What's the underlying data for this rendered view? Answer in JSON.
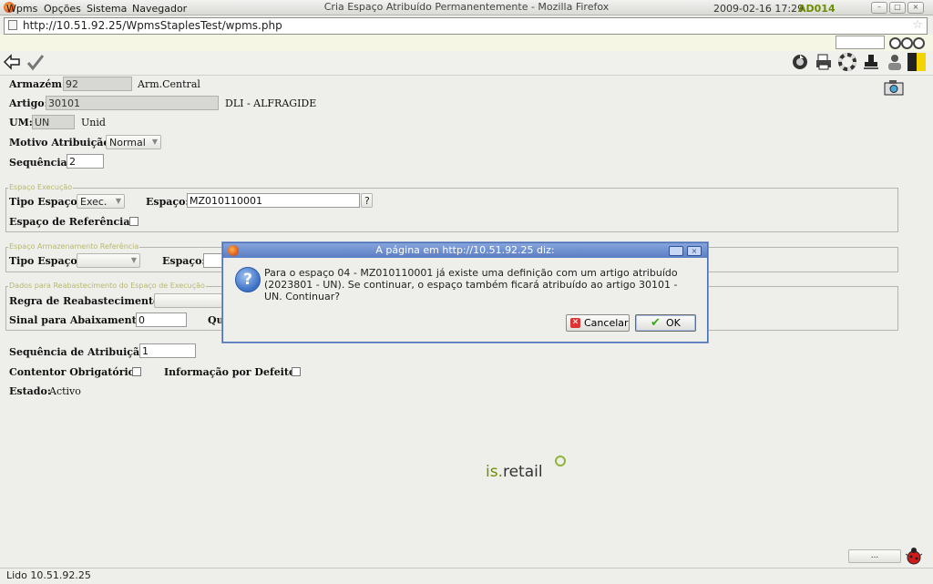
{
  "window": {
    "title": "Cria Espaço Atribuído Permanentemente - Mozilla Firefox"
  },
  "browser": {
    "url": "http://10.51.92.25/WpmsStaplesTest/wpms.php"
  },
  "menu": {
    "items": [
      "Wpms",
      "Opções",
      "Sistema",
      "Navegador"
    ],
    "datetime": "2009-02-16 17:29",
    "user": "AD014"
  },
  "form": {
    "armazem": {
      "label": "Armazém:",
      "value": "92",
      "desc": "Arm.Central"
    },
    "artigo": {
      "label": "Artigo:",
      "value": "30101",
      "desc": "DLI - ALFRAGIDE"
    },
    "um": {
      "label": "UM:",
      "value": "UN",
      "desc": "Unid"
    },
    "motivo": {
      "label": "Motivo Atribuição:",
      "value": "Normal"
    },
    "sequencia": {
      "label": "Sequência:",
      "value": "2"
    },
    "exec": {
      "legend": "Espaço Execução",
      "tipo_label": "Tipo Espaço:",
      "tipo_value": "Exec.",
      "espaco_label": "Espaço:",
      "espaco_value": "MZ010110001",
      "help": "?",
      "ref_label": "Espaço de Referência:"
    },
    "arm_ref": {
      "legend": "Espaço Armazenamento Referência",
      "tipo_label": "Tipo Espaço:",
      "espaco_label": "Espaço:"
    },
    "reab": {
      "legend": "Dados para Reabastecimento do Espaço de Execução",
      "regra_label": "Regra de Reabastecimento:",
      "sinal_label": "Sinal para Abaixamento:",
      "sinal_value": "0",
      "qu_label": "Qu"
    },
    "seq_atrib": {
      "label": "Sequência de Atribuição:",
      "value": "1"
    },
    "contentor": {
      "label": "Contentor Obrigatório:"
    },
    "info_defeito": {
      "label": "Informação por Defeito:"
    },
    "estado": {
      "label": "Estado:",
      "value": "Activo"
    }
  },
  "logo": {
    "text_a": "is.",
    "text_b": "retail"
  },
  "dialog": {
    "title": "A página em http://10.51.92.25 diz:",
    "message": "Para o espaço 04 - MZ010110001 já existe uma definição com um artigo atribuído (2023801 - UN). Se continuar, o espaço também ficará atribuído ao artigo 30101 - UN. Continuar?",
    "cancel_label": "Cancelar",
    "ok_label": "OK"
  },
  "bottom_button": "...",
  "status": "Lido 10.51.92.25",
  "colors": {
    "accent": "#6b8e00",
    "dialog_title": "#5a7ec4",
    "readonly_field": "#d7d7d3"
  }
}
